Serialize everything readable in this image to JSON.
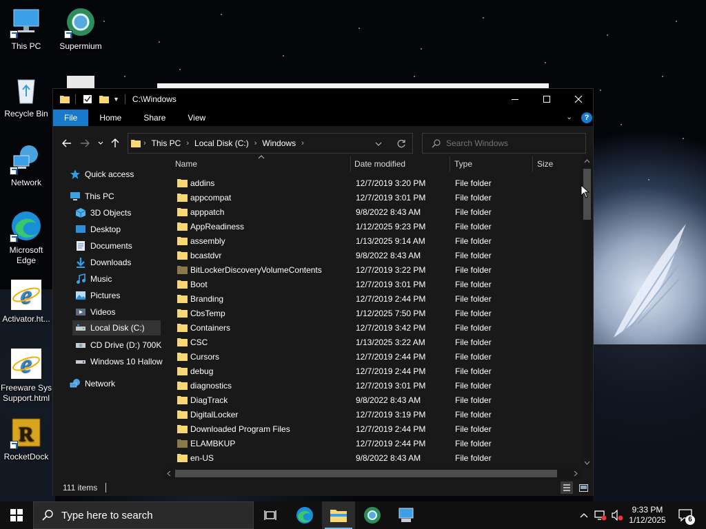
{
  "desktop": {
    "icons": [
      {
        "label": "This PC"
      },
      {
        "label": "Supermium"
      },
      {
        "label": "Recycle Bin"
      },
      {
        "label": "Network"
      },
      {
        "label": "Microsoft Edge"
      },
      {
        "label": "Activator.ht..."
      },
      {
        "label": "Freeware Sys Support.html"
      },
      {
        "label": "RocketDock"
      }
    ]
  },
  "window": {
    "title": "C:\\Windows",
    "ribbon_tabs": [
      "File",
      "Home",
      "Share",
      "View"
    ],
    "address": {
      "crumbs": [
        "This PC",
        "Local Disk (C:)",
        "Windows"
      ]
    },
    "search": {
      "placeholder": "Search Windows"
    },
    "columns": {
      "name": "Name",
      "date": "Date modified",
      "type": "Type",
      "size": "Size"
    },
    "nav": {
      "quick_access": "Quick access",
      "this_pc": "This PC",
      "children": [
        "3D Objects",
        "Desktop",
        "Documents",
        "Downloads",
        "Music",
        "Pictures",
        "Videos",
        "Local Disk (C:)",
        "CD Drive (D:) 700K",
        "Windows 10 Hallow"
      ],
      "network": "Network"
    },
    "files": [
      {
        "name": "addins",
        "date": "12/7/2019 3:20 PM",
        "type": "File folder"
      },
      {
        "name": "appcompat",
        "date": "12/7/2019 3:01 PM",
        "type": "File folder"
      },
      {
        "name": "apppatch",
        "date": "9/8/2022 8:43 AM",
        "type": "File folder"
      },
      {
        "name": "AppReadiness",
        "date": "1/12/2025 9:23 PM",
        "type": "File folder"
      },
      {
        "name": "assembly",
        "date": "1/13/2025 9:14 AM",
        "type": "File folder"
      },
      {
        "name": "bcastdvr",
        "date": "9/8/2022 8:43 AM",
        "type": "File folder"
      },
      {
        "name": "BitLockerDiscoveryVolumeContents",
        "date": "12/7/2019 3:22 PM",
        "type": "File folder"
      },
      {
        "name": "Boot",
        "date": "12/7/2019 3:01 PM",
        "type": "File folder"
      },
      {
        "name": "Branding",
        "date": "12/7/2019 2:44 PM",
        "type": "File folder"
      },
      {
        "name": "CbsTemp",
        "date": "1/12/2025 7:50 PM",
        "type": "File folder"
      },
      {
        "name": "Containers",
        "date": "12/7/2019 3:42 PM",
        "type": "File folder"
      },
      {
        "name": "CSC",
        "date": "1/13/2025 3:22 AM",
        "type": "File folder"
      },
      {
        "name": "Cursors",
        "date": "12/7/2019 2:44 PM",
        "type": "File folder"
      },
      {
        "name": "debug",
        "date": "12/7/2019 2:44 PM",
        "type": "File folder"
      },
      {
        "name": "diagnostics",
        "date": "12/7/2019 3:01 PM",
        "type": "File folder"
      },
      {
        "name": "DiagTrack",
        "date": "9/8/2022 8:43 AM",
        "type": "File folder"
      },
      {
        "name": "DigitalLocker",
        "date": "12/7/2019 3:19 PM",
        "type": "File folder"
      },
      {
        "name": "Downloaded Program Files",
        "date": "12/7/2019 2:44 PM",
        "type": "File folder"
      },
      {
        "name": "ELAMBKUP",
        "date": "12/7/2019 2:44 PM",
        "type": "File folder"
      },
      {
        "name": "en-US",
        "date": "9/8/2022 8:43 AM",
        "type": "File folder"
      }
    ],
    "status": {
      "items": "111 items"
    }
  },
  "taskbar": {
    "search_placeholder": "Type here to search",
    "clock_time": "9:33 PM",
    "clock_date": "1/12/2025",
    "notification_count": "6"
  },
  "colors": {
    "accent": "#1979ca",
    "folder": "#f8d775",
    "folder_hidden": "#8a7a4a"
  }
}
